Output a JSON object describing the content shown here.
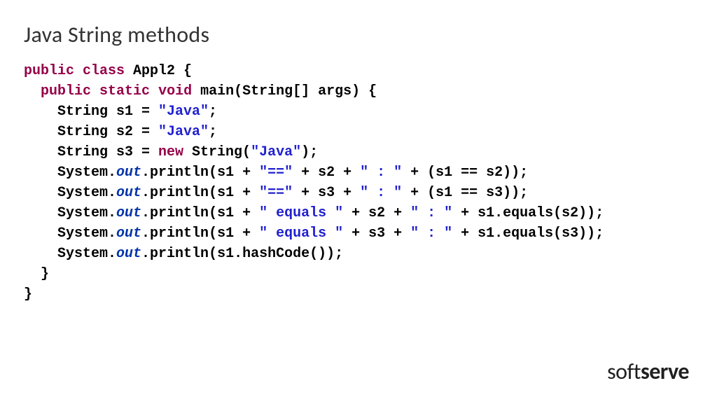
{
  "title": "Java String methods",
  "logo": {
    "light": "soft",
    "bold": "serve"
  },
  "code": {
    "public": "public",
    "class": "class",
    "static": "static",
    "void": "void",
    "new": "new",
    "className": " Appl2 {",
    "mainSig": " main(String[] args) {",
    "s1decl_a": "    String s1 = ",
    "s1decl_str": "\"Java\"",
    "semi": ";",
    "s2decl_a": "    String s2 = ",
    "s3decl_a": "    String s3 = ",
    "s3decl_b": " String(",
    "s3decl_c": ")",
    "sys": "    System.",
    "out": "out",
    "println": ".println(s1 + ",
    "println_h": ".println(s1.hashCode())",
    "eqeq": "\"==\"",
    "eqword": "\" equals \"",
    "colon": "\" : \"",
    "plus_s2_plus": " + s2 + ",
    "plus_s3_plus": " + s3 + ",
    "plus_open": " + (s1 == s2))",
    "plus_open3": " + (s1 == s3))",
    "plus_equals2": " + s1.equals(s2))",
    "plus_equals3": " + s1.equals(s3))",
    "close1": "  }",
    "close2": "}",
    "sp2": "  ",
    "sp1": " "
  }
}
